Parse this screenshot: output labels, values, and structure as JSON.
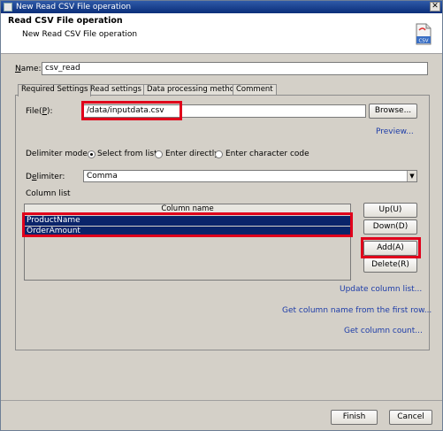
{
  "window": {
    "title": "New Read CSV File operation"
  },
  "header": {
    "title": "Read CSV File operation",
    "subtitle": "New Read CSV File operation",
    "icon": "csv-file-icon"
  },
  "name_field": {
    "label": "Name:",
    "label_mnemonic": "N",
    "value": "csv_read"
  },
  "tabs": [
    {
      "label": "Required Settings",
      "active": true
    },
    {
      "label": "Read settings",
      "active": false
    },
    {
      "label": "Data processing method",
      "active": false
    },
    {
      "label": "Comment",
      "active": false
    }
  ],
  "file_field": {
    "label_prefix": "File(",
    "label_mnemonic": "P",
    "label_suffix": "):",
    "value": "/data/inputdata.csv",
    "browse_label": "Browse...",
    "preview_label": "Preview..."
  },
  "delimiter_mode": {
    "label": "Delimiter mode:",
    "options": [
      {
        "label": "Select from list",
        "selected": true
      },
      {
        "label": "Enter directly",
        "selected": false
      },
      {
        "label": "Enter character code",
        "selected": false
      }
    ]
  },
  "delimiter": {
    "label": "Delimiter:",
    "label_mnemonic": "e",
    "value": "Comma"
  },
  "column_list": {
    "label": "Column list",
    "header": "Column name",
    "rows": [
      "ProductName",
      "OrderAmount"
    ],
    "buttons": {
      "up": "Up(U)",
      "down": "Down(D)",
      "add": "Add(A)",
      "delete": "Delete(R)"
    }
  },
  "links": {
    "update": "Update column list...",
    "get_names": "Get column name from the first row...",
    "get_count": "Get column count..."
  },
  "footer": {
    "finish": "Finish",
    "cancel": "Cancel"
  },
  "colors": {
    "highlight": "#e0001b",
    "selection": "#0a246a",
    "link": "#1d3ca8"
  }
}
